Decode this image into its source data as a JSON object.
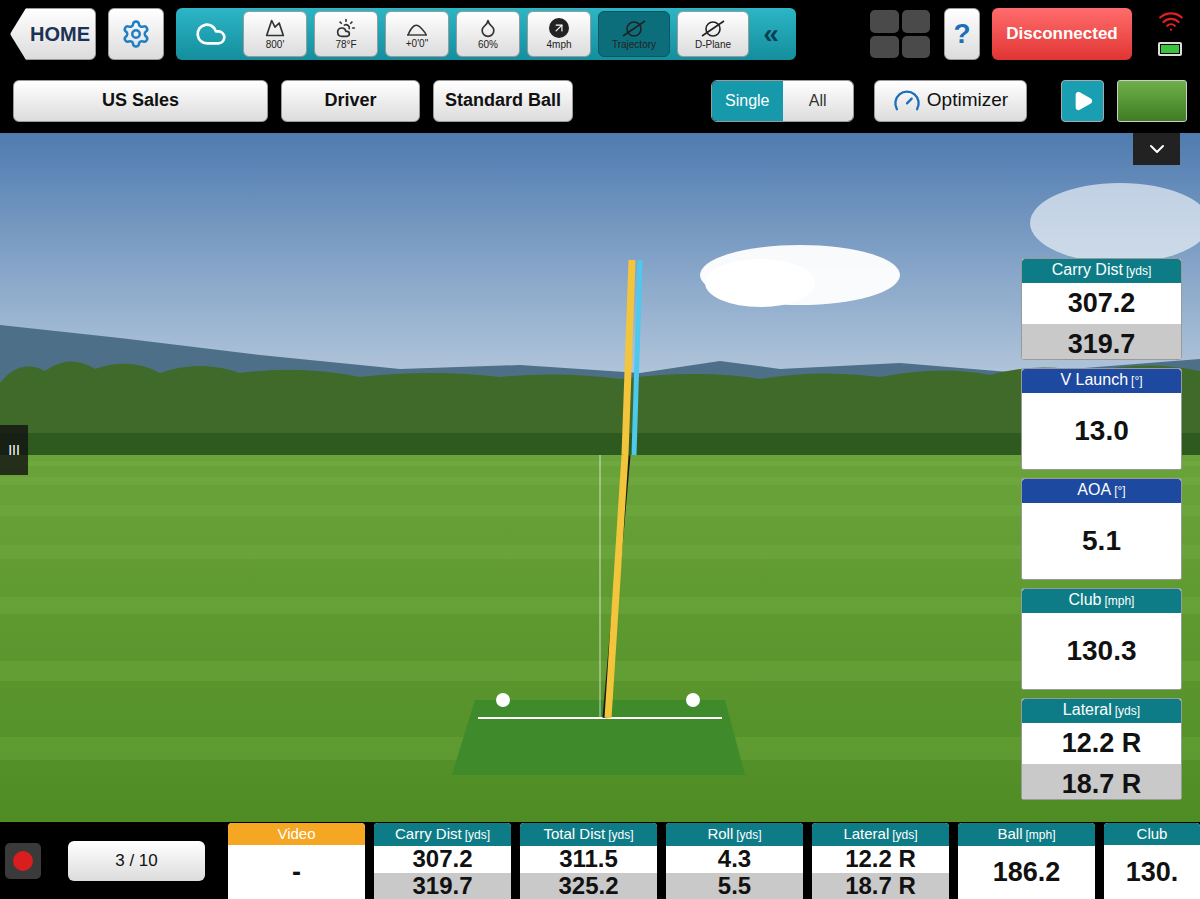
{
  "toolbar": {
    "home": "HOME",
    "conditions": [
      {
        "kind": "altitude",
        "label": "800'"
      },
      {
        "kind": "temperature",
        "label": "78°F"
      },
      {
        "kind": "slope",
        "label": "+0'0\""
      },
      {
        "kind": "humidity",
        "label": "60%"
      },
      {
        "kind": "wind",
        "label": "4mph"
      }
    ],
    "views": [
      {
        "label": "Trajectory",
        "selected": true
      },
      {
        "label": "D-Plane",
        "selected": false
      }
    ],
    "collapse": "«",
    "help": "?",
    "status": "Disconnected"
  },
  "selectors": [
    "US Sales",
    "Driver",
    "Standard Ball"
  ],
  "mode": [
    {
      "label": "Single",
      "selected": true
    },
    {
      "label": "All",
      "selected": false
    }
  ],
  "optimizer": "Optimizer",
  "side_tiles": [
    {
      "label": "Carry Dist",
      "unit": "[yds]",
      "values": [
        "307.2",
        "319.7"
      ],
      "color": "#0e7c86"
    },
    {
      "label": "V Launch",
      "unit": "[°]",
      "values": [
        "13.0"
      ],
      "color": "#1d4aa0"
    },
    {
      "label": "AOA",
      "unit": "[°]",
      "values": [
        "5.1"
      ],
      "color": "#1d4aa0"
    },
    {
      "label": "Club",
      "unit": "[mph]",
      "values": [
        "130.3"
      ],
      "color": "#0e7c86"
    },
    {
      "label": "Lateral",
      "unit": "[yds]",
      "values": [
        "12.2 R",
        "18.7 R"
      ],
      "color": "#0e7c86"
    }
  ],
  "handle": "III",
  "trajectories": [
    {
      "color": "#f2c53d"
    },
    {
      "color": "#4fc8ee"
    }
  ],
  "shot_counter": "3 / 10",
  "bottom_tiles": [
    {
      "label": "Video",
      "unit": "",
      "values": [
        "-"
      ],
      "color": "#f5a623"
    },
    {
      "label": "Carry Dist",
      "unit": "[yds]",
      "values": [
        "307.2",
        "319.7"
      ],
      "color": "#0e7c86"
    },
    {
      "label": "Total Dist",
      "unit": "[yds]",
      "values": [
        "311.5",
        "325.2"
      ],
      "color": "#0e7c86"
    },
    {
      "label": "Roll",
      "unit": "[yds]",
      "values": [
        "4.3",
        "5.5"
      ],
      "color": "#0e7c86"
    },
    {
      "label": "Lateral",
      "unit": "[yds]",
      "values": [
        "12.2 R",
        "18.7 R"
      ],
      "color": "#0e7c86"
    },
    {
      "label": "Ball",
      "unit": "[mph]",
      "values": [
        "186.2"
      ],
      "color": "#0e7c86"
    },
    {
      "label": "Club",
      "unit": "",
      "values": [
        "130."
      ],
      "color": "#0e7c86"
    }
  ]
}
